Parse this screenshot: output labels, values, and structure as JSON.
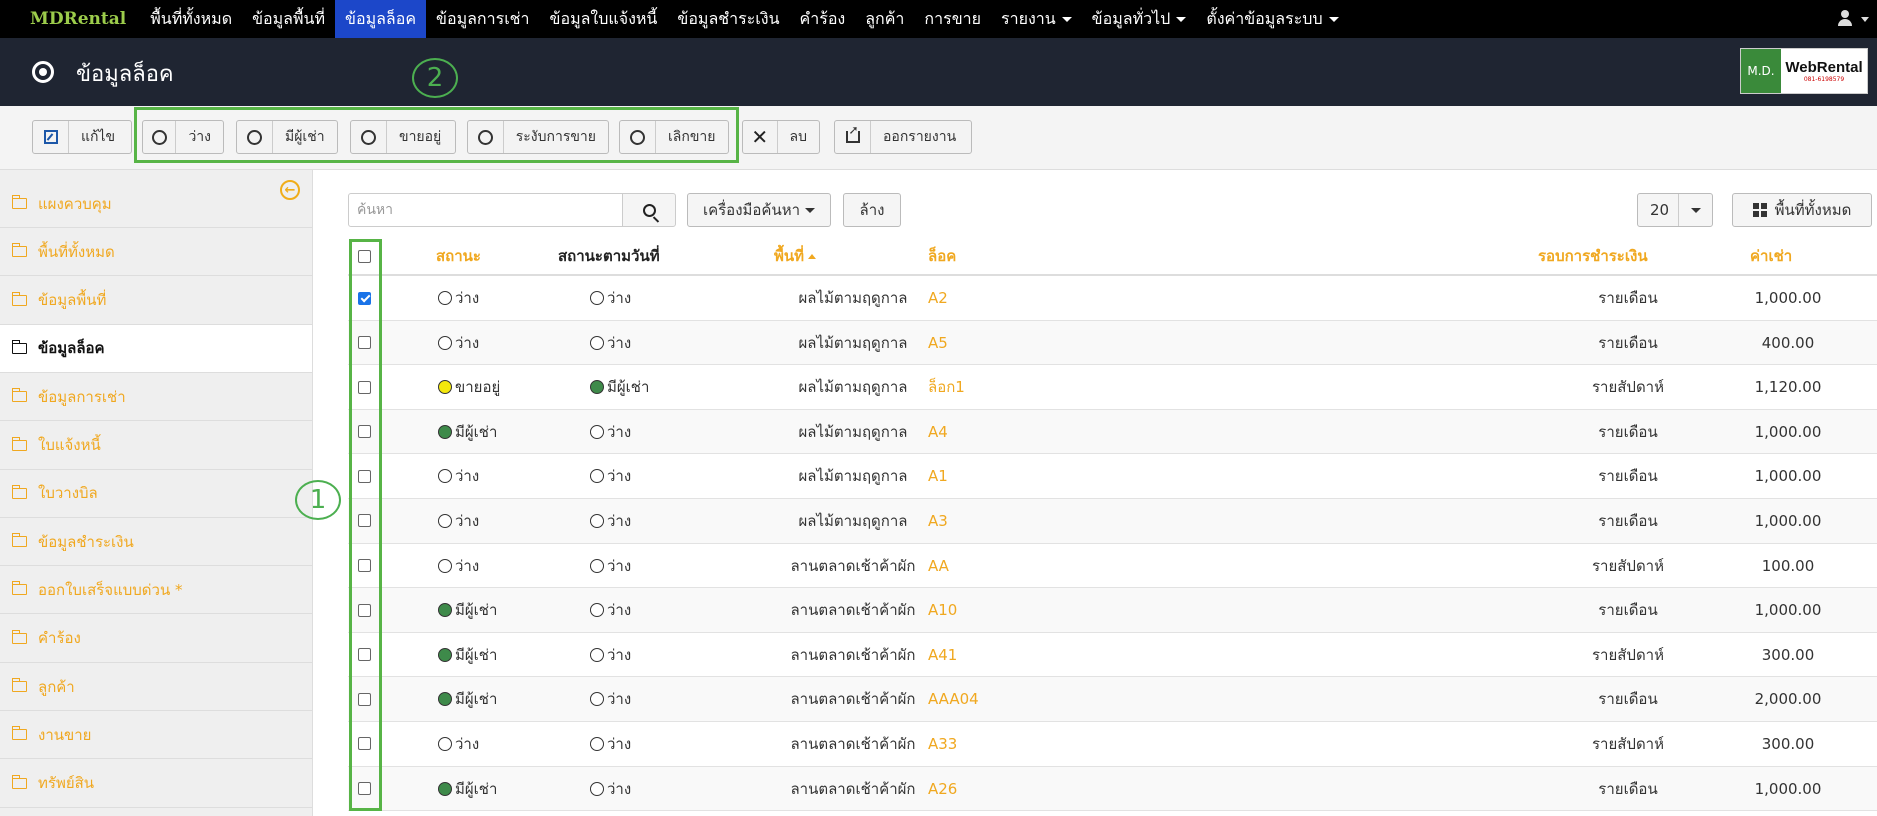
{
  "nav": {
    "brand": "MDRental",
    "items": [
      {
        "label": "พื้นที่ทั้งหมด"
      },
      {
        "label": "ข้อมูลพื้นที่"
      },
      {
        "label": "ข้อมูลล็อค",
        "active": true
      },
      {
        "label": "ข้อมูลการเช่า"
      },
      {
        "label": "ข้อมูลใบแจ้งหนี้"
      },
      {
        "label": "ข้อมูลชำระเงิน"
      },
      {
        "label": "คำร้อง"
      },
      {
        "label": "ลูกค้า"
      },
      {
        "label": "การขาย"
      },
      {
        "label": "รายงาน",
        "dropdown": true
      },
      {
        "label": "ข้อมูลทั่วไป",
        "dropdown": true
      },
      {
        "label": "ตั้งค่าข้อมูลระบบ",
        "dropdown": true
      }
    ],
    "user_icon": "user-icon"
  },
  "header": {
    "title": "ข้อมูลล็อค",
    "icon": "dot-circle-icon",
    "logo": {
      "left": "M.D.",
      "right": "WebRental",
      "tagline": "081-6198579"
    }
  },
  "toolbar": {
    "edit": "แก้ไข",
    "status_buttons": [
      "ว่าง",
      "มีผู้เช่า",
      "ขายอยู่",
      "ระงับการขาย",
      "เลิกขาย"
    ],
    "delete": "ลบ",
    "export": "ออกรายงาน"
  },
  "callouts": [
    "1",
    "2"
  ],
  "sidebar": {
    "items": [
      {
        "label": "แผงควบคุม"
      },
      {
        "label": "พื้นที่ทั้งหมด"
      },
      {
        "label": "ข้อมูลพื้นที่"
      },
      {
        "label": "ข้อมูลล็อค",
        "active": true
      },
      {
        "label": "ข้อมูลการเช่า"
      },
      {
        "label": "ใบแจ้งหนี้"
      },
      {
        "label": "ใบวางบิล"
      },
      {
        "label": "ข้อมูลชำระเงิน"
      },
      {
        "label": "ออกใบเสร็จแบบด่วน *"
      },
      {
        "label": "คำร้อง"
      },
      {
        "label": "ลูกค้า"
      },
      {
        "label": "งานขาย"
      },
      {
        "label": "ทรัพย์สิน"
      }
    ]
  },
  "search": {
    "placeholder": "ค้นหา",
    "tools_label": "เครื่องมือค้นหา",
    "clear_label": "ล้าง",
    "page_size": "20",
    "all_areas_label": "พื้นที่ทั้งหมด"
  },
  "table": {
    "headers": {
      "status": "สถานะ",
      "status_by_date": "สถานะตามวันที่",
      "area": "พื้นที่",
      "lock": "ล็อค",
      "payment_cycle": "รอบการชำระเงิน",
      "rent": "ค่าเช่า"
    },
    "rows": [
      {
        "checked": true,
        "status": "ว่าง",
        "status_color": "empty",
        "date_status": "ว่าง",
        "date_color": "empty",
        "area": "ผลไม้ตามฤดูกาล",
        "lock": "A2",
        "cycle": "รายเดือน",
        "rent": "1,000.00"
      },
      {
        "checked": false,
        "status": "ว่าง",
        "status_color": "empty",
        "date_status": "ว่าง",
        "date_color": "empty",
        "area": "ผลไม้ตามฤดูกาล",
        "lock": "A5",
        "cycle": "รายเดือน",
        "rent": "400.00"
      },
      {
        "checked": false,
        "status": "ขายอยู่",
        "status_color": "yellow",
        "date_status": "มีผู้เช่า",
        "date_color": "green",
        "area": "ผลไม้ตามฤดูกาล",
        "lock": "ล็อก1",
        "cycle": "รายสัปดาห์",
        "rent": "1,120.00"
      },
      {
        "checked": false,
        "status": "มีผู้เช่า",
        "status_color": "green",
        "date_status": "ว่าง",
        "date_color": "empty",
        "area": "ผลไม้ตามฤดูกาล",
        "lock": "A4",
        "cycle": "รายเดือน",
        "rent": "1,000.00"
      },
      {
        "checked": false,
        "status": "ว่าง",
        "status_color": "empty",
        "date_status": "ว่าง",
        "date_color": "empty",
        "area": "ผลไม้ตามฤดูกาล",
        "lock": "A1",
        "cycle": "รายเดือน",
        "rent": "1,000.00"
      },
      {
        "checked": false,
        "status": "ว่าง",
        "status_color": "empty",
        "date_status": "ว่าง",
        "date_color": "empty",
        "area": "ผลไม้ตามฤดูกาล",
        "lock": "A3",
        "cycle": "รายเดือน",
        "rent": "1,000.00"
      },
      {
        "checked": false,
        "status": "ว่าง",
        "status_color": "empty",
        "date_status": "ว่าง",
        "date_color": "empty",
        "area": "ลานตลาดเช้าค้าผัก",
        "lock": "AA",
        "cycle": "รายสัปดาห์",
        "rent": "100.00"
      },
      {
        "checked": false,
        "status": "มีผู้เช่า",
        "status_color": "green",
        "date_status": "ว่าง",
        "date_color": "empty",
        "area": "ลานตลาดเช้าค้าผัก",
        "lock": "A10",
        "cycle": "รายเดือน",
        "rent": "1,000.00"
      },
      {
        "checked": false,
        "status": "มีผู้เช่า",
        "status_color": "green",
        "date_status": "ว่าง",
        "date_color": "empty",
        "area": "ลานตลาดเช้าค้าผัก",
        "lock": "A41",
        "cycle": "รายสัปดาห์",
        "rent": "300.00"
      },
      {
        "checked": false,
        "status": "มีผู้เช่า",
        "status_color": "green",
        "date_status": "ว่าง",
        "date_color": "empty",
        "area": "ลานตลาดเช้าค้าผัก",
        "lock": "AAA04",
        "cycle": "รายเดือน",
        "rent": "2,000.00"
      },
      {
        "checked": false,
        "status": "ว่าง",
        "status_color": "empty",
        "date_status": "ว่าง",
        "date_color": "empty",
        "area": "ลานตลาดเช้าค้าผัก",
        "lock": "A33",
        "cycle": "รายสัปดาห์",
        "rent": "300.00"
      },
      {
        "checked": false,
        "status": "มีผู้เช่า",
        "status_color": "green",
        "date_status": "ว่าง",
        "date_color": "empty",
        "area": "ลานตลาดเช้าค้าผัก",
        "lock": "A26",
        "cycle": "รายเดือน",
        "rent": "1,000.00"
      }
    ]
  },
  "colors": {
    "nav_bg": "#000000",
    "nav_active": "#1c47c9",
    "header_bg": "#1f2532",
    "accent_orange": "#f0a820",
    "annotation_green": "#57b446",
    "status_green": "#3e8a4a",
    "status_yellow": "#f4e80c"
  }
}
